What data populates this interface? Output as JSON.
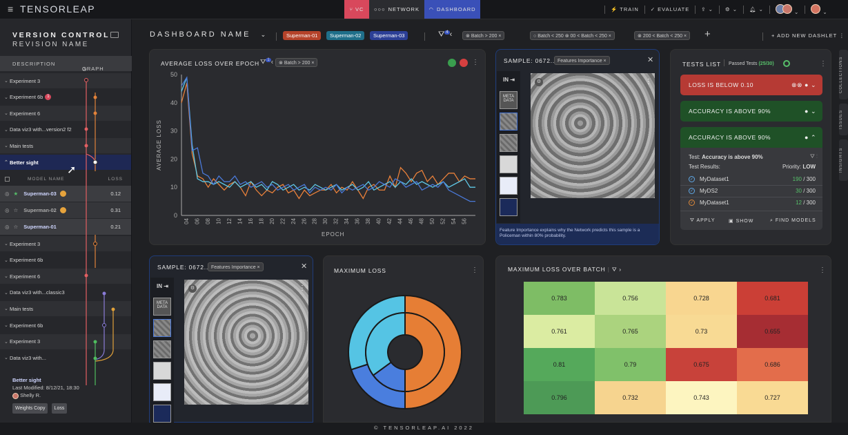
{
  "topbar": {
    "brand": "TENSORLEAP",
    "vc_label": "VC",
    "network_label": "NETWORK",
    "dashboard_label": "DASHBOARD",
    "train_label": "TRAIN",
    "evaluate_label": "EVALUATE"
  },
  "sidebar": {
    "title": "VERSION CONTROL",
    "subtitle": "REVISION NAME",
    "col_description": "DESCRIPTION",
    "col_graph": "GRAPH",
    "items_top": [
      {
        "label": "Experiment 3"
      },
      {
        "label": "Experiment 6b",
        "badge": "1"
      },
      {
        "label": "Experiment 6"
      },
      {
        "label": "Data viz3 with...version2 f2"
      },
      {
        "label": "Main tests"
      },
      {
        "label": "Better sight"
      }
    ],
    "model_head": {
      "name": "MODEL NAME",
      "loss": "LOSS"
    },
    "models": [
      {
        "name": "Superman-03",
        "loss": "0.12"
      },
      {
        "name": "Superman-02",
        "loss": "0.31"
      },
      {
        "name": "Superman-01",
        "loss": "0.21"
      }
    ],
    "items_bottom": [
      {
        "label": "Experiment 3"
      },
      {
        "label": "Experiment 6b"
      },
      {
        "label": "Experiment 6"
      },
      {
        "label": "Data viz3 with...classic3"
      },
      {
        "label": "Main tests"
      },
      {
        "label": "Experiment 6b"
      },
      {
        "label": "Experiment 3"
      },
      {
        "label": "Data viz3 with..."
      }
    ],
    "footer": {
      "name": "Better sight",
      "modified": "Last Modified: 8/12/21, 18:30",
      "user": "Shelly R.",
      "chips": [
        "Weights Copy",
        "Loss"
      ]
    }
  },
  "header": {
    "dashboard_name": "DASHBOARD NAME",
    "model_tags": [
      {
        "label": "Superman-01",
        "color": "#c8502f"
      },
      {
        "label": "Superman-02",
        "color": "#2b8fb0"
      },
      {
        "label": "Superman-03",
        "color": "#3a57c4"
      }
    ],
    "filter_badge": "4",
    "filters": [
      "Batch > 200",
      "Batch < 250",
      "00 < Batch < 250",
      "200 < Batch < 250"
    ],
    "add_dashlet": "ADD NEW DASHLET"
  },
  "loss_card": {
    "title": "AVERAGE LOSS OVER EPOCH",
    "filter_badge": "1",
    "filter_chip": "Batch > 200"
  },
  "sample_top": {
    "title": "SAMPLE: 0672...",
    "tag": "Features Importance",
    "in_label": "IN",
    "meta_label": "META DATA",
    "caption": "Feature Importance explains why the Network predicts this sample is a Policeman within 80% probability."
  },
  "sample_bottom": {
    "title": "SAMPLE: 0672...",
    "tag": "Features Importance",
    "in_label": "IN",
    "meta_label": "META DATA"
  },
  "tests": {
    "title": "TESTS LIST",
    "passed_label": "Passed Tests",
    "passed_value": "(25/30)",
    "items": [
      {
        "label": "LOSS IS BELOW 0.10",
        "color": "#b83a35"
      },
      {
        "label": "ACCURACY IS ABOVE 90%",
        "color": "#215a2a"
      },
      {
        "label": "ACCURACY IS ABOVE 90%",
        "color": "#215a2a"
      }
    ],
    "detail": {
      "test_prefix": "Test:",
      "test_name": "Accuracy is above 90%",
      "results_label": "Test Results:",
      "priority_label": "Priority:",
      "priority_value": "LOW",
      "rows": [
        {
          "name": "MyDataset1",
          "pass": "190",
          "total": "/ 300",
          "color": "#57c06a"
        },
        {
          "name": "MyDS2",
          "pass": "30",
          "total": "/ 300",
          "color": "#57c06a"
        },
        {
          "name": "MyDataset1",
          "pass": "12",
          "total": "/ 300",
          "color": "#57c06a"
        }
      ],
      "apply": "APPLY",
      "show": "SHOW",
      "find_models": "FIND MODELS"
    }
  },
  "maxloss": {
    "title": "MAXIMUM LOSS"
  },
  "heatmap_card": {
    "title": "MAXIMUM LOSS OVER BATCH"
  },
  "footer": "© TENSORLEAP.AI 2022",
  "side_tabs": [
    "COLLECTIONS",
    "ISSUES",
    "INSIGHTS"
  ],
  "chart_data": [
    {
      "type": "line",
      "title": "AVERAGE LOSS OVER EPOCH",
      "xlabel": "EPOCH",
      "ylabel": "AVERAGE LOSS",
      "ylim": [
        0,
        50
      ],
      "yticks": [
        0,
        10,
        20,
        30,
        40,
        50
      ],
      "xticks": [
        "04",
        "06",
        "08",
        "10",
        "12",
        "14",
        "16",
        "18",
        "20",
        "22",
        "24",
        "26",
        "28",
        "30",
        "32",
        "34",
        "36",
        "38",
        "40",
        "42",
        "44",
        "46",
        "48",
        "50",
        "52",
        "54",
        "56"
      ],
      "x": [
        3,
        4,
        5,
        6,
        7,
        8,
        9,
        10,
        11,
        12,
        13,
        14,
        15,
        16,
        17,
        18,
        19,
        20,
        21,
        22,
        23,
        24,
        25,
        26,
        27,
        28,
        29,
        30,
        31,
        32,
        33,
        34,
        35,
        36,
        37,
        38,
        39,
        40,
        41,
        42,
        43,
        44,
        45,
        46,
        47,
        48,
        49,
        50,
        51,
        52,
        53,
        54,
        55,
        56,
        57,
        58
      ],
      "series": [
        {
          "color": "#e9803a",
          "values": [
            40,
            47,
            22,
            14,
            13,
            10,
            13,
            11,
            9,
            11,
            12,
            10,
            7,
            12,
            9,
            7,
            9,
            8,
            10,
            11,
            8,
            9,
            6,
            9,
            7,
            8,
            9,
            9,
            11,
            8,
            10,
            9,
            12,
            9,
            6,
            10,
            11,
            9,
            9,
            14,
            10,
            17,
            15,
            12,
            15,
            16,
            12,
            14,
            11,
            13,
            15,
            15,
            12,
            14,
            13,
            13
          ]
        },
        {
          "color": "#5fc8e6",
          "values": [
            44,
            49,
            25,
            13,
            12,
            12,
            11,
            12,
            11,
            10,
            12,
            10,
            11,
            12,
            10,
            11,
            9,
            12,
            11,
            9,
            10,
            11,
            9,
            10,
            9,
            11,
            10,
            9,
            10,
            11,
            9,
            10,
            11,
            9,
            10,
            12,
            9,
            10,
            11,
            12,
            10,
            12,
            11,
            13,
            11,
            12,
            11,
            10,
            11,
            12,
            10,
            11,
            12,
            13,
            10,
            10
          ]
        },
        {
          "color": "#4a79d8",
          "values": [
            46,
            49,
            23,
            24,
            15,
            14,
            11,
            14,
            12,
            12,
            14,
            11,
            12,
            10,
            11,
            12,
            10,
            11,
            9,
            10,
            11,
            9,
            10,
            11,
            8,
            10,
            9,
            10,
            9,
            11,
            8,
            10,
            9,
            10,
            11,
            9,
            10,
            12,
            11,
            10,
            13,
            12,
            10,
            11,
            12,
            9,
            10,
            11,
            10,
            12,
            9,
            8,
            7,
            6,
            5,
            5
          ]
        }
      ]
    },
    {
      "type": "pie",
      "title": "MAXIMUM LOSS",
      "rings": [
        {
          "name": "outer",
          "values": [
            50,
            20,
            30
          ],
          "colors": [
            "#e67e35",
            "#4a7ede",
            "#55c4e4"
          ]
        },
        {
          "name": "inner",
          "values": [
            50,
            15,
            35
          ],
          "colors": [
            "#e67e35",
            "#4a7ede",
            "#55c4e4"
          ]
        }
      ]
    },
    {
      "type": "heatmap",
      "title": "MAXIMUM LOSS OVER BATCH",
      "rows": [
        {
          "values": [
            0.783,
            0.756,
            0.728,
            0.681
          ],
          "colors": [
            "#7ebd65",
            "#c9e498",
            "#f8d690",
            "#cb3f36"
          ]
        },
        {
          "values": [
            0.761,
            0.765,
            0.73,
            0.655
          ],
          "colors": [
            "#dbeca2",
            "#abd37e",
            "#f8da94",
            "#a62d33"
          ]
        },
        {
          "values": [
            0.81,
            0.79,
            0.675,
            0.686
          ],
          "colors": [
            "#55a95b",
            "#80c16a",
            "#c8423a",
            "#e36d4b"
          ]
        },
        {
          "values": [
            0.796,
            0.732,
            0.743,
            0.727
          ],
          "colors": [
            "#4d9a56",
            "#f6d48f",
            "#fdf5c0",
            "#f9da94"
          ]
        }
      ]
    }
  ]
}
